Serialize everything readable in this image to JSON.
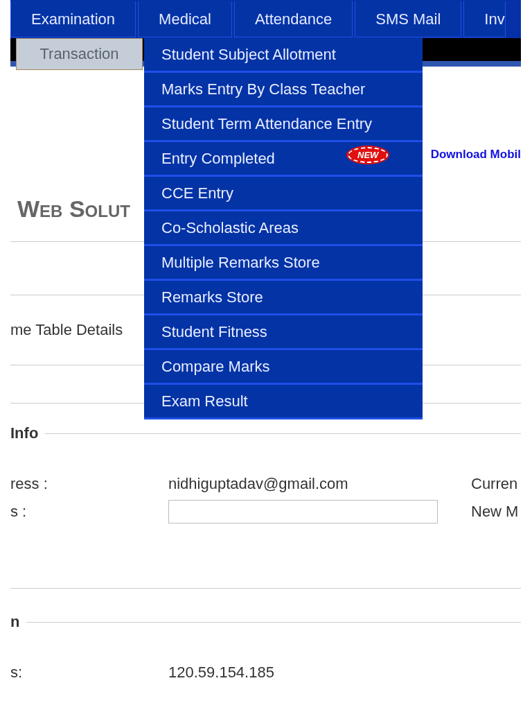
{
  "nav_tabs": [
    {
      "label": "Examination"
    },
    {
      "label": "Medical"
    },
    {
      "label": "Attendance"
    },
    {
      "label": "SMS Mail"
    },
    {
      "label": "Inv"
    }
  ],
  "submenu_button": "Transaction",
  "dropdown_items": [
    "Student Subject Allotment",
    "Marks Entry By Class Teacher",
    "Student Term Attendance Entry",
    "Entry Completed",
    "CCE Entry",
    "Co-Scholastic Areas",
    "Multiple Remarks Store",
    "Remarks Store",
    "Student Fitness",
    "Compare Marks",
    "Exam Result"
  ],
  "announcement": {
    "badge": "NEW",
    "link": "Download Mobil"
  },
  "page_title": "Web Solut",
  "link_text": "me Table Details",
  "sections": [
    {
      "heading": "Info",
      "rows": [
        {
          "kind": "text",
          "label": "ress :",
          "value": "nidhiguptadav@gmail.com",
          "side_label": "Curren"
        },
        {
          "kind": "input",
          "label": "s :",
          "side_label": "New M"
        }
      ]
    },
    {
      "heading": "n",
      "rows": [
        {
          "kind": "text",
          "label": "s:",
          "value": "120.59.154.185"
        }
      ]
    }
  ]
}
